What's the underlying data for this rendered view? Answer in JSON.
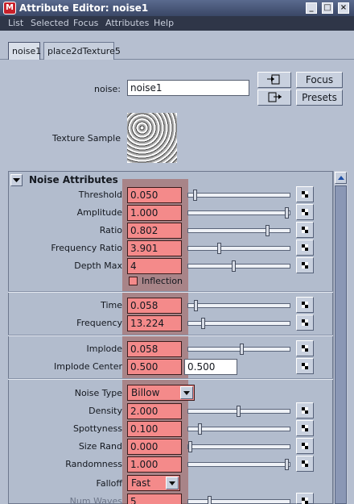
{
  "window": {
    "title": "Attribute Editor: noise1",
    "controls": [
      "_",
      "□",
      "×"
    ]
  },
  "menu": [
    "List",
    "Selected",
    "Focus",
    "Attributes",
    "Help"
  ],
  "tabs": [
    "noise1",
    "place2dTexture5"
  ],
  "header": {
    "node_label": "noise:",
    "node_value": "noise1",
    "focus_label": "Focus",
    "presets_label": "Presets",
    "texture_sample_label": "Texture Sample"
  },
  "section": {
    "title": "Noise Attributes"
  },
  "attributes": {
    "threshold": {
      "label": "Threshold",
      "value": "0.050",
      "slider": 0.05
    },
    "amplitude": {
      "label": "Amplitude",
      "value": "1.000",
      "slider": 1.0
    },
    "ratio": {
      "label": "Ratio",
      "value": "0.802",
      "slider": 0.8
    },
    "frequency_ratio": {
      "label": "Frequency Ratio",
      "value": "3.901",
      "slider": 0.3
    },
    "depth_max": {
      "label": "Depth Max",
      "value": "4",
      "slider": 0.45
    },
    "inflection": {
      "label": "Inflection",
      "checked": false
    },
    "time": {
      "label": "Time",
      "value": "0.058",
      "slider": 0.06
    },
    "frequency": {
      "label": "Frequency",
      "value": "13.224",
      "slider": 0.13
    },
    "implode": {
      "label": "Implode",
      "value": "0.058",
      "slider": 0.53
    },
    "implode_center": {
      "label": "Implode Center",
      "value_u": "0.500",
      "value_v": "0.500"
    },
    "noise_type": {
      "label": "Noise Type",
      "value": "Billow"
    },
    "density": {
      "label": "Density",
      "value": "2.000",
      "slider": 0.5
    },
    "spottyness": {
      "label": "Spottyness",
      "value": "0.100",
      "slider": 0.1
    },
    "size_rand": {
      "label": "Size Rand",
      "value": "0.000",
      "slider": 0.0
    },
    "randomness": {
      "label": "Randomness",
      "value": "1.000",
      "slider": 1.0
    },
    "falloff": {
      "label": "Falloff",
      "value": "Fast"
    },
    "num_waves": {
      "label": "Num Waves",
      "value": "5",
      "slider": 0.2
    }
  }
}
